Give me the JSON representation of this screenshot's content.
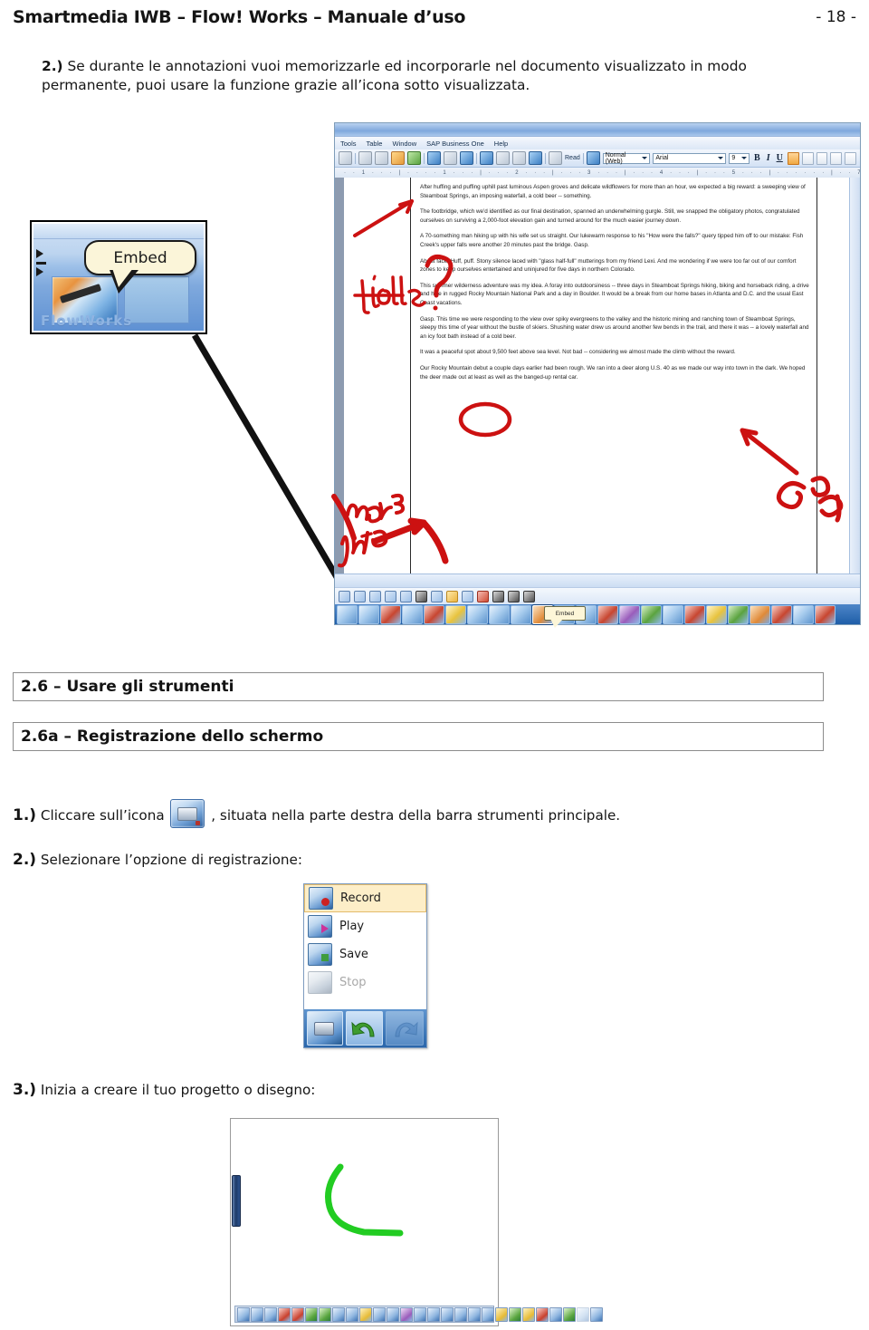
{
  "header": {
    "doc_title": "Smartmedia IWB – Flow! Works – Manuale d’uso",
    "page_number": "- 18 -"
  },
  "intro": {
    "number": "2.)",
    "text": "Se durante le annotazioni vuoi memorizzarle ed incorporarle nel documento visualizzato in modo permanente, puoi usare la funzione grazie all’icona sotto visualizzata."
  },
  "figure": {
    "zoom_callout": {
      "tooltip_label": "Embed",
      "wordmark": "FlowWorks"
    },
    "word_window": {
      "menu_items": [
        "Tools",
        "Table",
        "Window",
        "SAP Business One",
        "Help"
      ],
      "read_button": "Read",
      "style_value": "Normal (Web)",
      "font_value": "Arial",
      "size_value": "9",
      "bold_label": "B",
      "italic_label": "I",
      "underline_label": "U",
      "ruler_ticks": "· · 1 · · · | · · · · 1 · · · | · · · 2 · · · | · · · 3 · · · | · · · 4 · · · | · · · 5 · · · | · · · · · · | · · 7 ·",
      "document_paragraphs": [
        "After huffing and puffing uphill past luminous Aspen groves and delicate wildflowers for more than an hour, we expected a big reward: a sweeping view of Steamboat Springs, an imposing waterfall, a cold beer -- something.",
        "The footbridge, which we'd identified as our final destination, spanned an underwhelming gurgle. Still, we snapped the obligatory photos, congratulated ourselves on surviving a 2,000-foot elevation gain and turned around for the much easier journey down.",
        "A 70-something man hiking up with his wife set us straight. Our lukewarm response to his \"How were the falls?\" query tipped him off to our mistake: Fish Creek's upper falls were another 20 minutes past the bridge. Gasp.",
        "About face. Huff, puff. Stony silence laced with \"glass half-full\" mutterings from my friend Lexi. And me wondering if we were too far out of our comfort zones to keep ourselves entertained and uninjured for five days in northern Colorado.",
        "This summer wilderness adventure was my idea. A foray into outdoorsiness -- three days in Steamboat Springs hiking, biking and horseback riding, a drive and hike in rugged Rocky Mountain National Park and a day in Boulder. It would be a break from our home bases in Atlanta and D.C. and the usual East Coast vacations.",
        "Gasp. This time we were responding to the view over spiky evergreens to the valley and the historic mining and ranching town of Steamboat Springs, sleepy this time of year without the bustle of skiers. Shushing water drew us around another few bends in the trail, and there it was -- a lovely waterfall and an icy foot bath instead of a cold beer.",
        "It was a peaceful spot about 9,500 feet above sea level. Not bad -- considering we almost made the climb without the reward.",
        "Our Rocky Mountain debut a couple days earlier had been rough. We ran into a deer along U.S. 40 as we made our way into town in the dark. We hoped the deer made out at least as well as the banged-up rental car."
      ],
      "toolbar_tooltip": "Embed",
      "annotations": [
        "title?",
        "more info",
        "Gasp"
      ]
    }
  },
  "sections": [
    {
      "id": "2.6",
      "title": "2.6 – Usare gli strumenti"
    },
    {
      "id": "2.6a",
      "title": "2.6a – Registrazione dello schermo"
    }
  ],
  "steps": [
    {
      "number": "1.)",
      "text_before": "Cliccare sull’icona",
      "text_after": ", situata nella parte destra della barra strumenti principale."
    },
    {
      "number": "2.)",
      "text_before": "Selezionare l’opzione di registrazione:",
      "text_after": ""
    },
    {
      "number": "3.)",
      "text_before": "Inizia a creare il tuo progetto o disegno:",
      "text_after": ""
    }
  ],
  "record_menu": {
    "items": [
      {
        "label": "Record",
        "state": "highlighted"
      },
      {
        "label": "Play",
        "state": "enabled"
      },
      {
        "label": "Save",
        "state": "enabled"
      },
      {
        "label": "Stop",
        "state": "disabled"
      }
    ]
  },
  "colors": {
    "annotation_red": "#cc1111",
    "stroke_green": "#22cc22",
    "highlight_amber": "#fdeec8",
    "window_blue": "#2a66ab"
  }
}
